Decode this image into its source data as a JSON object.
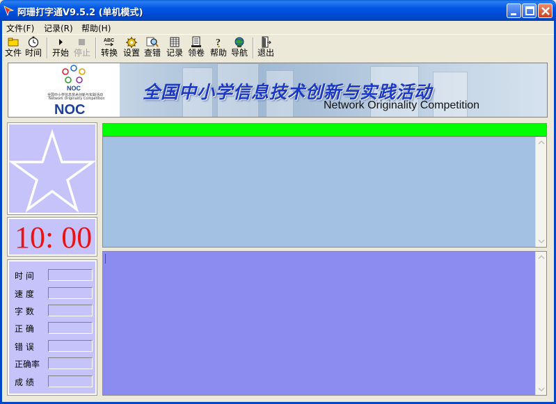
{
  "window": {
    "title": "阿珊打字通V9.5.2 (单机模式)"
  },
  "menu": {
    "items": [
      "文件(F)",
      "记录(R)",
      "帮助(H)"
    ]
  },
  "toolbar": {
    "buttons": [
      {
        "label": "文件",
        "icon": "folder-icon",
        "enabled": true
      },
      {
        "label": "时间",
        "icon": "stopwatch-icon",
        "enabled": true
      },
      {
        "label": "开始",
        "icon": "play-icon",
        "enabled": true
      },
      {
        "label": "停止",
        "icon": "stop-icon",
        "enabled": false
      },
      {
        "label": "转换",
        "icon": "abc-convert-icon",
        "enabled": true
      },
      {
        "label": "设置",
        "icon": "gear-icon",
        "enabled": true
      },
      {
        "label": "查错",
        "icon": "magnifier-icon",
        "enabled": true
      },
      {
        "label": "记录",
        "icon": "record-grid-icon",
        "enabled": true
      },
      {
        "label": "领卷",
        "icon": "paper-icon",
        "enabled": true
      },
      {
        "label": "帮助",
        "icon": "help-icon",
        "enabled": true
      },
      {
        "label": "导航",
        "icon": "globe-icon",
        "enabled": true
      },
      {
        "label": "退出",
        "icon": "exit-door-icon",
        "enabled": true
      }
    ]
  },
  "banner": {
    "logo_text": "NOC",
    "logo_small": "NOC",
    "logo_line1": "全国中小学信息技术创新与实践活动",
    "logo_line2": "Network Originality Competition",
    "title": "全国中小学信息技术创新与实践活动",
    "subtitle": "Network Originality Competition"
  },
  "timer": {
    "display": "10: 00"
  },
  "stats": {
    "labels": [
      "时  间",
      "速  度",
      "字  数",
      "正  确",
      "错  误",
      "正确率",
      "成  绩"
    ]
  },
  "progress": {
    "fraction": 1.0,
    "color": "#00ff00"
  },
  "colors": {
    "panel_lilac": "#c6c3fb",
    "clock_red": "#ee1111",
    "source_area": "#a3c1e2",
    "input_area": "#8b8bf0"
  }
}
